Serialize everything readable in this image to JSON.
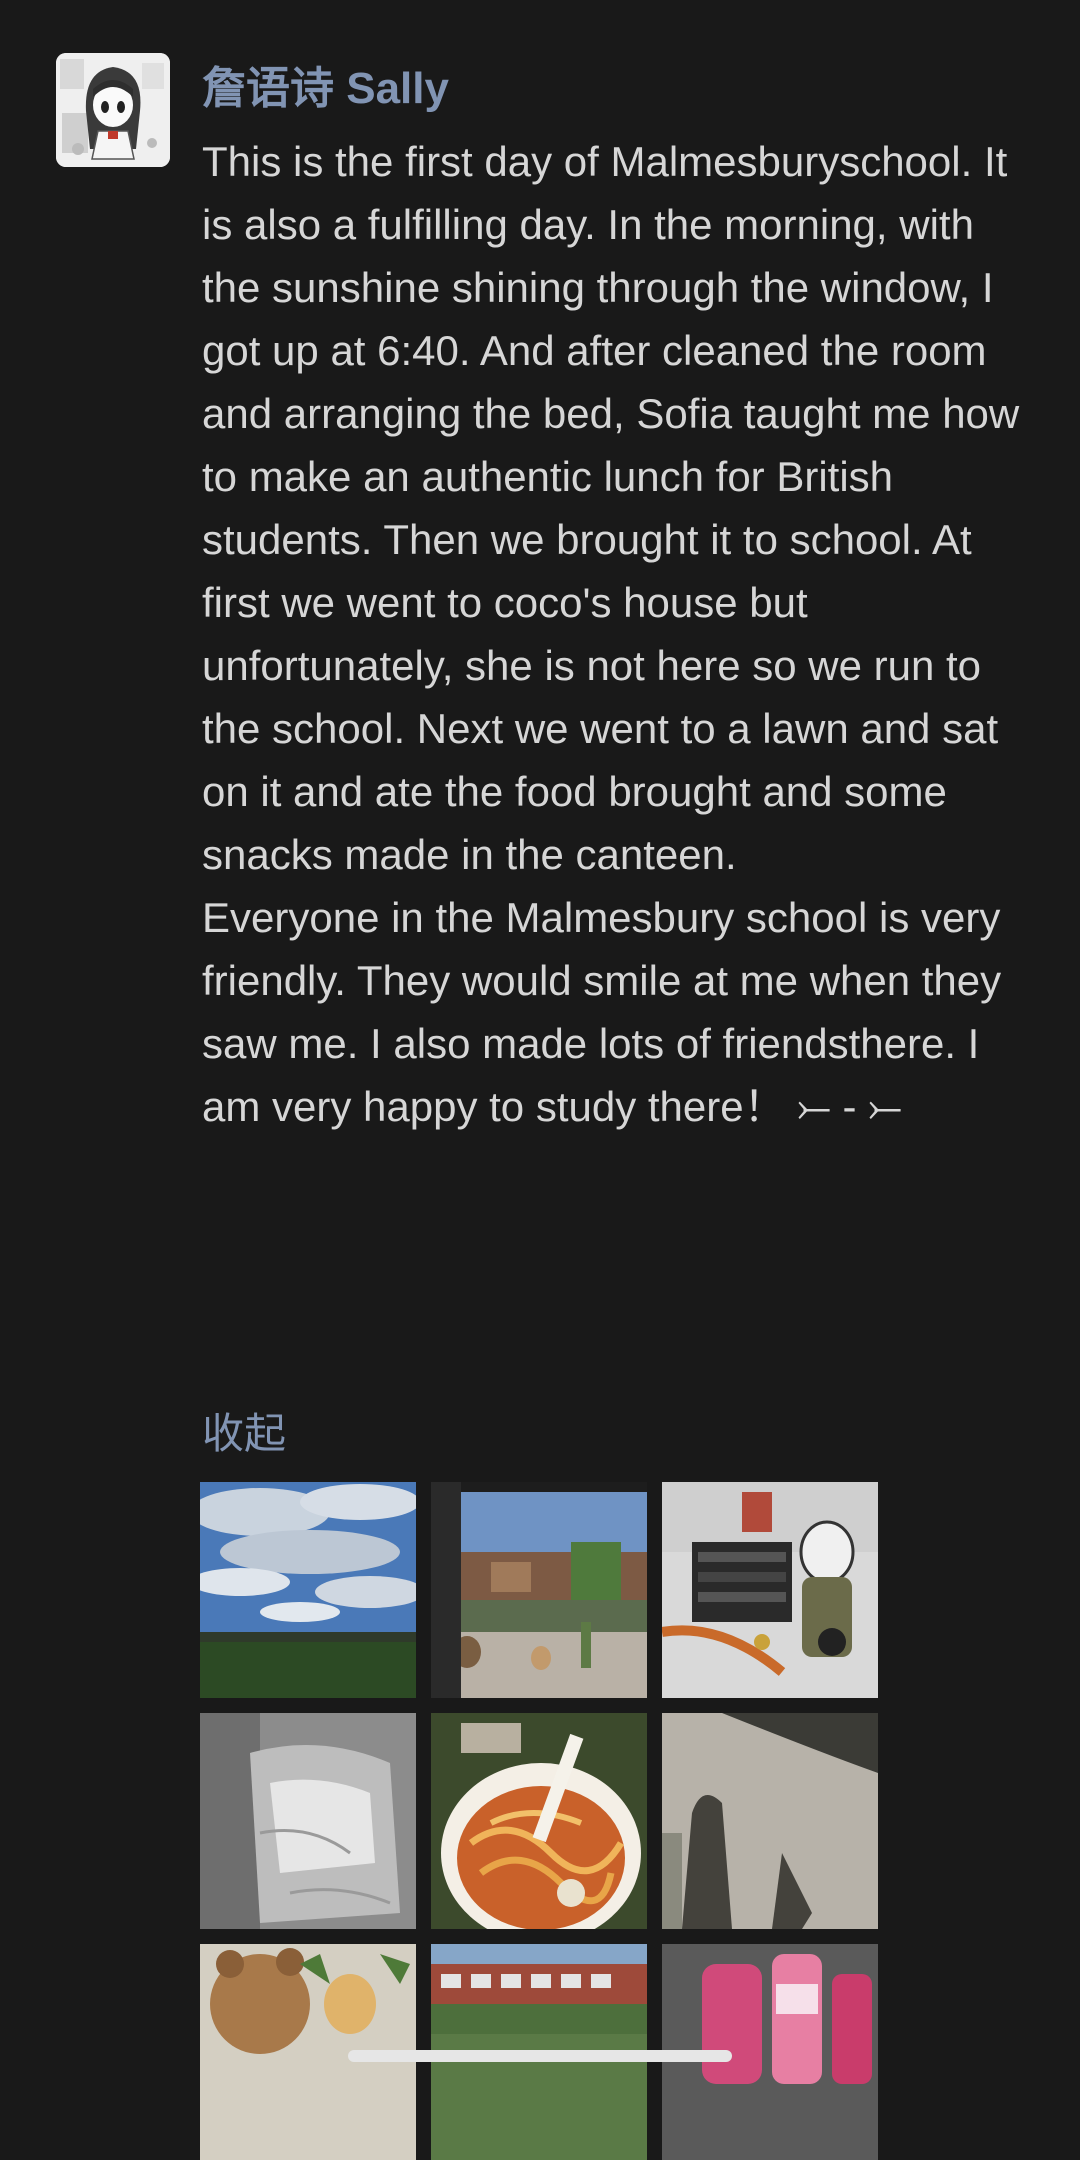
{
  "post": {
    "author": "詹语诗 Sally",
    "paragraphs": [
      "This is the first day of Malmesburyschool. It is also a fulfilling day. In the morning, with the sunshine shining through the window, I got up at 6:40. And after cleaned the room and arranging the bed, Sofia taught me how to make an authentic lunch for British students. Then we brought it to school. At first we went to coco's house but unfortunately, she is not here so we run to the school. Next we went to a lawn and sat on it and ate the food brought and some snacks made in the canteen.",
      "Everyone in the Malmesbury school is very friendly. They would smile at me when they saw me. I also made lots of friendsthere. I am very happy to study there！ ⤚ - ⤚"
    ],
    "collapse_label": "收起"
  },
  "photos": [
    {
      "name": "photo-sky-field"
    },
    {
      "name": "photo-window-view"
    },
    {
      "name": "photo-desk-items"
    },
    {
      "name": "photo-bedsheet"
    },
    {
      "name": "photo-pasta-bowl"
    },
    {
      "name": "photo-shadow-pavement"
    },
    {
      "name": "photo-teddy-bear"
    },
    {
      "name": "photo-school-building"
    },
    {
      "name": "photo-pink-bottles"
    }
  ],
  "colors": {
    "background": "#191919",
    "author_name": "#8194b3",
    "body_text": "#d6d6d6",
    "link": "#8194b3"
  }
}
